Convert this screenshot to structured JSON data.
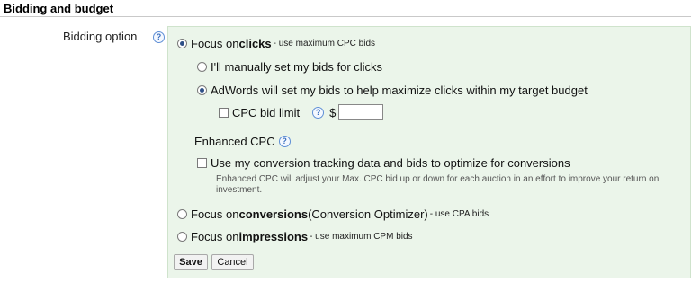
{
  "section": {
    "title": "Bidding and budget"
  },
  "bidding_option": {
    "label": "Bidding option",
    "help": "?"
  },
  "options": {
    "focus_clicks": {
      "prefix": "Focus on ",
      "bold": "clicks",
      "suffix": " - use maximum CPC bids"
    },
    "manual_bids": {
      "label": "I'll manually set my bids for clicks"
    },
    "auto_bids": {
      "label": "AdWords will set my bids to help maximize clicks within my target budget"
    },
    "cpc_limit": {
      "label": "CPC bid limit",
      "help": "?",
      "currency": "$",
      "value": ""
    },
    "enhanced_cpc": {
      "label": "Enhanced CPC",
      "help": "?"
    },
    "conversion_tracking": {
      "label": "Use my conversion tracking data and bids to optimize for conversions",
      "description": "Enhanced CPC will adjust your Max. CPC bid up or down for each auction in an effort to improve your return on investment."
    },
    "focus_conversions": {
      "prefix": "Focus on ",
      "bold": "conversions",
      "middle": " (Conversion Optimizer)",
      "suffix": " - use CPA bids"
    },
    "focus_impressions": {
      "prefix": "Focus on ",
      "bold": "impressions",
      "suffix": " - use maximum CPM bids"
    }
  },
  "buttons": {
    "save": "Save",
    "cancel": "Cancel"
  }
}
